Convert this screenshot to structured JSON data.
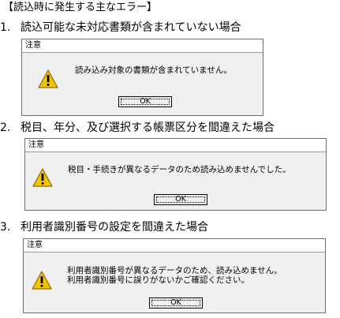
{
  "heading": "【読込時に発生する主なエラー】",
  "sections": [
    {
      "number": "1.",
      "title": "読込可能な未対応書類が含まれていない場合",
      "dialog": {
        "title": "注意",
        "message_lines": [
          "読み込み対象の書類が含まれていません。"
        ],
        "ok_label": "OK",
        "icon": "warning-icon"
      }
    },
    {
      "number": "2.",
      "title": "税目、年分、及び選択する帳票区分を間違えた場合",
      "dialog": {
        "title": "注意",
        "message_lines": [
          "税目・手続きが異なるデータのため読み込めませんでした。"
        ],
        "ok_label": "OK",
        "icon": "warning-icon"
      }
    },
    {
      "number": "3.",
      "title": "利用者識別番号の設定を間違えた場合",
      "dialog": {
        "title": "注意",
        "message_lines": [
          "利用者識別番号が異なるデータのため、読み込めません。",
          "利用者識別番号に誤りがないかご確認ください。"
        ],
        "ok_label": "OK",
        "icon": "warning-icon"
      }
    }
  ],
  "colors": {
    "dialog_bg": "#f0f0f0",
    "warning_fill": "#f5c400",
    "warning_stroke": "#8a6d00"
  }
}
